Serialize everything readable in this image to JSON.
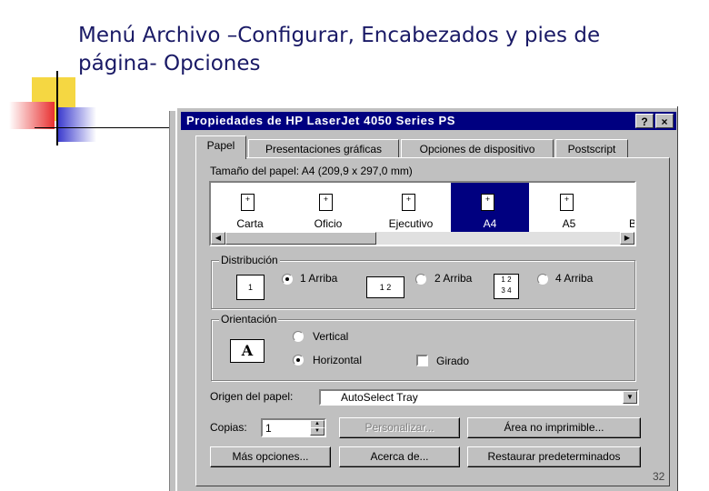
{
  "slide": {
    "title_line1": "Menú Archivo –Configurar, Encabezados y pies de",
    "title_line2": "página- Opciones",
    "page_number": "32"
  },
  "dialog": {
    "title": "Propiedades de HP LaserJet 4050 Series PS",
    "help_button": "?",
    "close_button": "×",
    "tabs": [
      "Papel",
      "Presentaciones gráficas",
      "Opciones de dispositivo",
      "Postscript"
    ],
    "active_tab": "Papel",
    "paper_size_label": "Tamaño del papel:",
    "paper_size_value": "A4 (209,9 x 297,0 mm)",
    "paper_sizes": [
      "Carta",
      "Oficio",
      "Ejecutivo",
      "A4",
      "A5",
      "B"
    ],
    "selected_paper": "A4",
    "layout_group": "Distribución",
    "layout_options": [
      "1 Arriba",
      "2 Arriba",
      "4 Arriba"
    ],
    "layout_selected": "1 Arriba",
    "layout_icon_digits": [
      "1",
      "1",
      "2",
      "1",
      "2",
      "3",
      "4"
    ],
    "orientation_group": "Orientación",
    "orientation_options": [
      "Vertical",
      "Horizontal"
    ],
    "orientation_selected": "Horizontal",
    "orientation_icon_letter": "A",
    "rotated_label": "Girado",
    "rotated_checked": false,
    "paper_source_label": "Origen del papel:",
    "paper_source_value": "AutoSelect Tray",
    "copies_label": "Copias:",
    "copies_value": "1",
    "buttons": {
      "customize": "Personalizar...",
      "unprintable": "Área no imprimible...",
      "more_options": "Más opciones...",
      "about": "Acerca de...",
      "restore": "Restaurar predeterminados"
    }
  },
  "colors": {
    "title_text": "#1a1a66",
    "dialog_face": "#c0c0c0",
    "titlebar": "#000080",
    "deco_yellow": "#f5d742",
    "deco_red": "#e83030",
    "deco_blue": "#3333cc"
  }
}
